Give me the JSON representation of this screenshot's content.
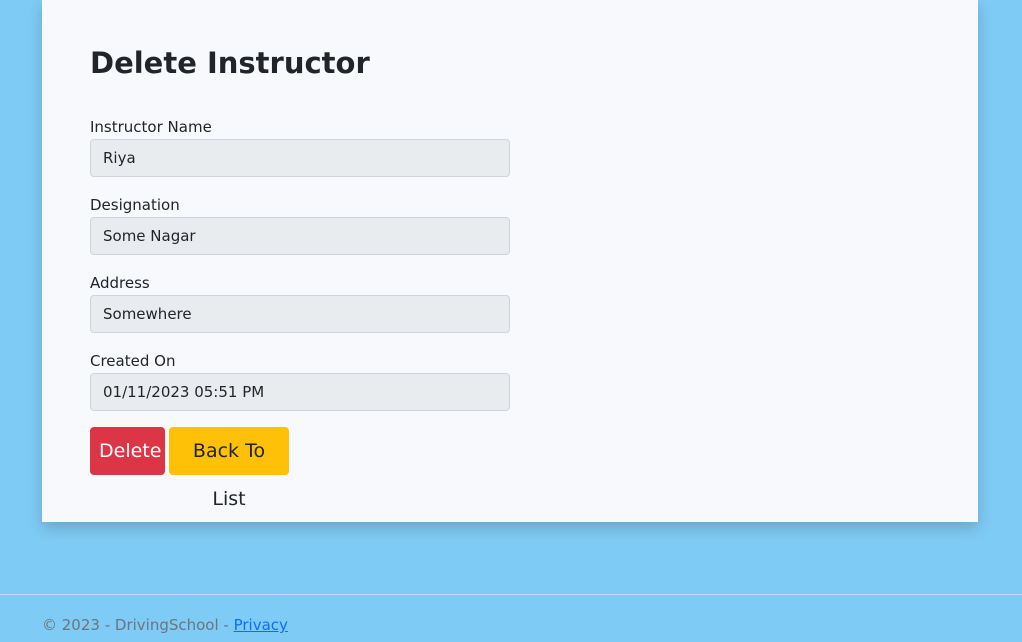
{
  "page": {
    "title": "Delete Instructor"
  },
  "form": {
    "instructor_name": {
      "label": "Instructor Name",
      "value": "Riya"
    },
    "designation": {
      "label": "Designation",
      "value": "Some Nagar"
    },
    "address": {
      "label": "Address",
      "value": "Somewhere"
    },
    "created_on": {
      "label": "Created On",
      "value": "01/11/2023 05:51 PM"
    }
  },
  "actions": {
    "delete_label": "Delete",
    "back_label": "Back To List"
  },
  "footer": {
    "copyright": "© 2023 - DrivingSchool - ",
    "privacy_label": "Privacy"
  },
  "colors": {
    "page_background": "#7ecbf5",
    "card_background": "#f8f9fc",
    "delete_button": "#dc3545",
    "back_button": "#ffc107",
    "link": "#0d6efd"
  }
}
